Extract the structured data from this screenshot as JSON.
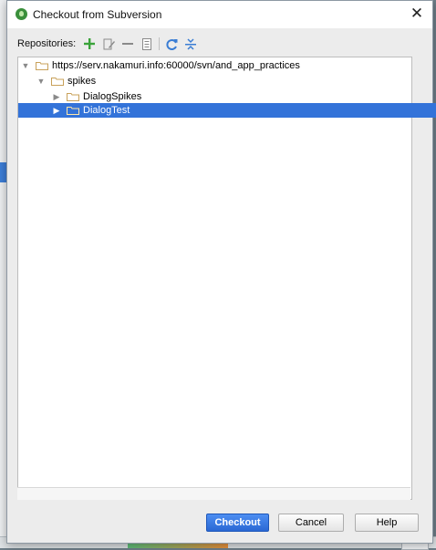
{
  "dialog": {
    "title": "Checkout from Subversion",
    "close_glyph": "✕"
  },
  "toolbar": {
    "label": "Repositories:",
    "icons": [
      "add-icon",
      "edit-icon",
      "remove-icon",
      "browse-icon",
      "refresh-icon",
      "collapse-all-icon"
    ]
  },
  "tree": {
    "root": {
      "label": "https://serv.nakamuri.info:60000/svn/and_app_practices",
      "expanded": true
    },
    "spikes": {
      "label": "spikes",
      "expanded": true
    },
    "children": [
      {
        "label": "DialogSpikes",
        "expanded": false,
        "selected": false
      },
      {
        "label": "DialogTest",
        "expanded": false,
        "selected": true
      }
    ]
  },
  "buttons": {
    "checkout": "Checkout",
    "cancel": "Cancel",
    "help": "Help"
  },
  "colors": {
    "selection": "#3373d9",
    "primary_button": "#2a68d4",
    "add_icon": "#3aa33a",
    "refresh_icon": "#3a7dd4",
    "folder": "#c8a15a"
  }
}
